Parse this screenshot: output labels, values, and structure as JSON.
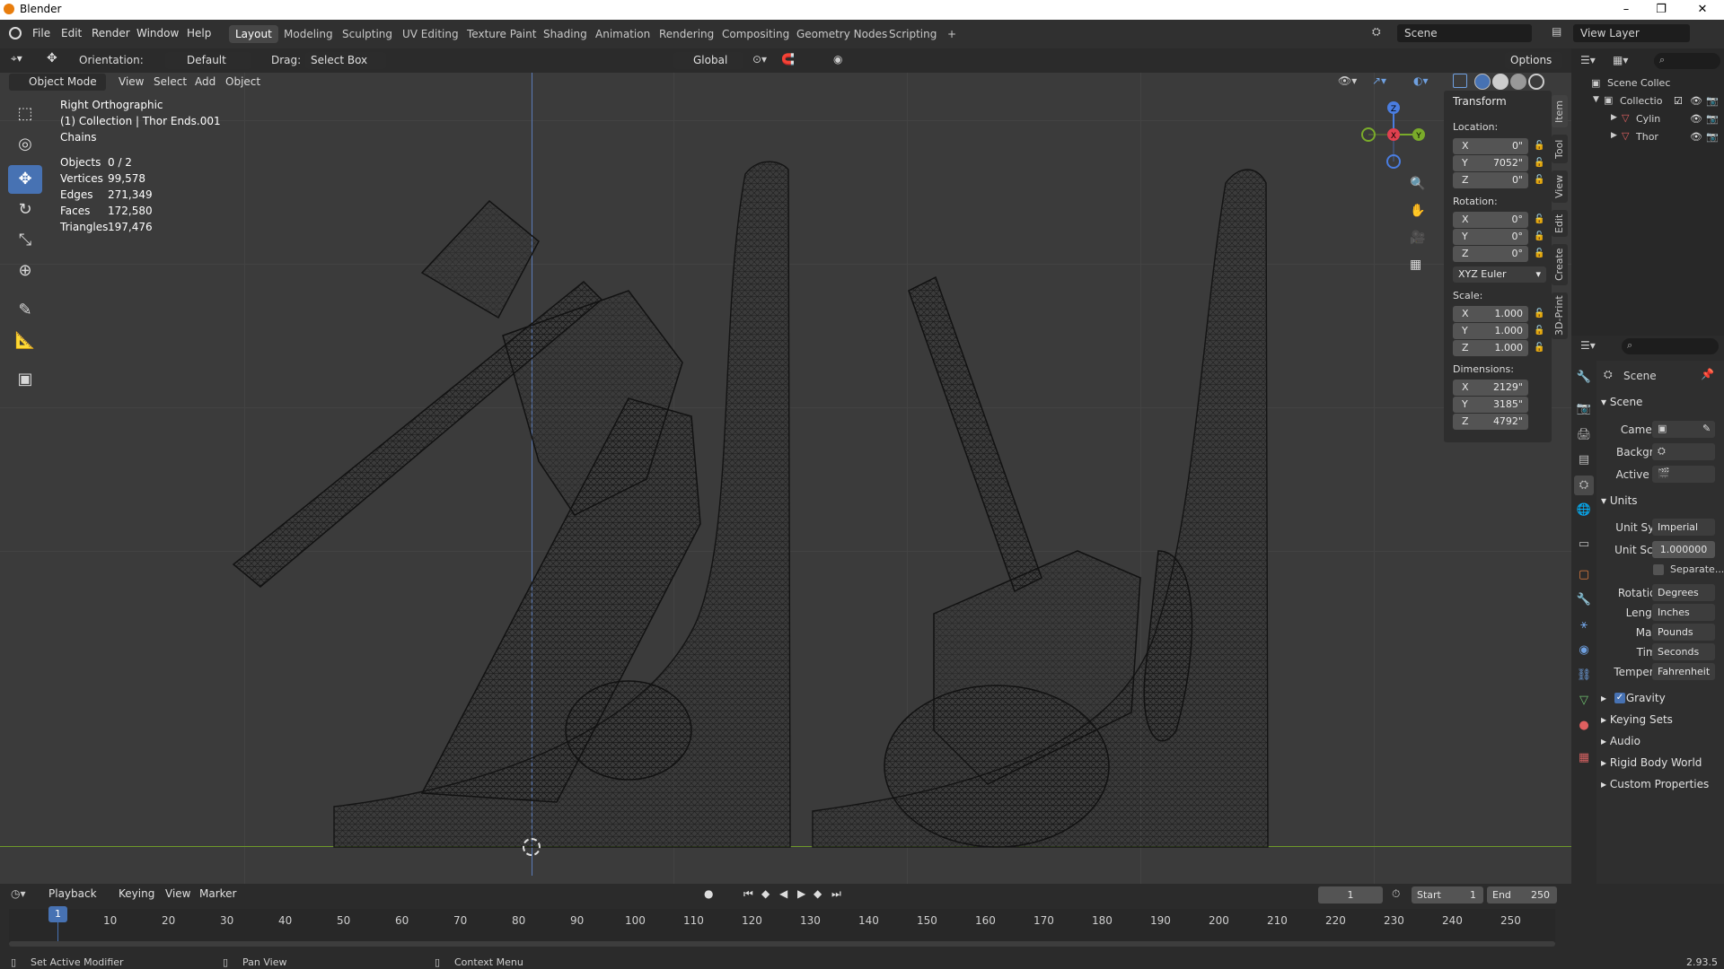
{
  "window": {
    "title": "Blender",
    "minimize": "–",
    "maximize": "❐",
    "close": "✕"
  },
  "menu": [
    "File",
    "Edit",
    "Render",
    "Window",
    "Help"
  ],
  "workspaces": [
    "Layout",
    "Modeling",
    "Sculpting",
    "UV Editing",
    "Texture Paint",
    "Shading",
    "Animation",
    "Rendering",
    "Compositing",
    "Geometry Nodes",
    "Scripting",
    "+"
  ],
  "scene_selector": "Scene",
  "view_layer_selector": "View Layer",
  "tool_header": {
    "orientation_label": "Orientation:",
    "orientation_value": "Default",
    "drag_label": "Drag:",
    "drag_value": "Select Box",
    "transform_orientation": "Global",
    "options": "Options"
  },
  "viewport_header": {
    "mode": "Object Mode",
    "view": "View",
    "select": "Select",
    "add": "Add",
    "object": "Object"
  },
  "overlay_text": {
    "view_name": "Right Orthographic",
    "collection": "(1) Collection | Thor Ends.001",
    "object": "Chains"
  },
  "stats": [
    {
      "label": "Objects",
      "value": "0 / 2"
    },
    {
      "label": "Vertices",
      "value": "99,578"
    },
    {
      "label": "Edges",
      "value": "271,349"
    },
    {
      "label": "Faces",
      "value": "172,580"
    },
    {
      "label": "Triangles",
      "value": "197,476"
    }
  ],
  "gizmo": {
    "x": "X",
    "y": "Y",
    "z": "Z"
  },
  "transform": {
    "title": "Transform",
    "location_label": "Location:",
    "location": [
      {
        "axis": "X",
        "value": "0\""
      },
      {
        "axis": "Y",
        "value": "7052\""
      },
      {
        "axis": "Z",
        "value": "0\""
      }
    ],
    "rotation_label": "Rotation:",
    "rotation": [
      {
        "axis": "X",
        "value": "0°"
      },
      {
        "axis": "Y",
        "value": "0°"
      },
      {
        "axis": "Z",
        "value": "0°"
      }
    ],
    "rotation_mode": "XYZ Euler",
    "scale_label": "Scale:",
    "scale": [
      {
        "axis": "X",
        "value": "1.000"
      },
      {
        "axis": "Y",
        "value": "1.000"
      },
      {
        "axis": "Z",
        "value": "1.000"
      }
    ],
    "dimensions_label": "Dimensions:",
    "dimensions": [
      {
        "axis": "X",
        "value": "2129\""
      },
      {
        "axis": "Y",
        "value": "3185\""
      },
      {
        "axis": "Z",
        "value": "4792\""
      }
    ]
  },
  "sidebar_tabs": [
    "Item",
    "Tool",
    "View",
    "Edit",
    "Create",
    "3D-Print"
  ],
  "outliner": {
    "root": "Scene Collec",
    "items": [
      {
        "name": "Collectio"
      },
      {
        "name": "Cylin"
      },
      {
        "name": "Thor"
      }
    ]
  },
  "properties": {
    "header": "Scene",
    "scene_section": "Scene",
    "camera_label": "Camera",
    "background_label": "Backgr...",
    "active_label": "Active ...",
    "units_section": "Units",
    "unit_system_label": "Unit Sy...",
    "unit_system": "Imperial",
    "unit_scale_label": "Unit Sc...",
    "unit_scale": "1.000000",
    "separate_label": "Separate...",
    "rotation_label": "Rotation",
    "rotation": "Degrees",
    "length_label": "Length",
    "length": "Inches",
    "mass_label": "Mass",
    "mass": "Pounds",
    "time_label": "Time",
    "time": "Seconds",
    "temperature_label": "Temper...",
    "temperature": "Fahrenheit",
    "collapsed": [
      "Gravity",
      "Keying Sets",
      "Audio",
      "Rigid Body World",
      "Custom Properties"
    ]
  },
  "timeline": {
    "playback": "Playback",
    "keying": "Keying",
    "view": "View",
    "marker": "Marker",
    "current_frame": "1",
    "start_label": "Start",
    "start": "1",
    "end_label": "End",
    "end": "250",
    "ticks": [
      "1",
      "10",
      "20",
      "30",
      "40",
      "50",
      "60",
      "70",
      "80",
      "90",
      "100",
      "110",
      "120",
      "130",
      "140",
      "150",
      "160",
      "170",
      "180",
      "190",
      "200",
      "210",
      "220",
      "230",
      "240",
      "250"
    ]
  },
  "statusbar": {
    "left": "Set Active Modifier",
    "middle": "Pan View",
    "right": "Context Menu",
    "version": "2.93.5"
  }
}
